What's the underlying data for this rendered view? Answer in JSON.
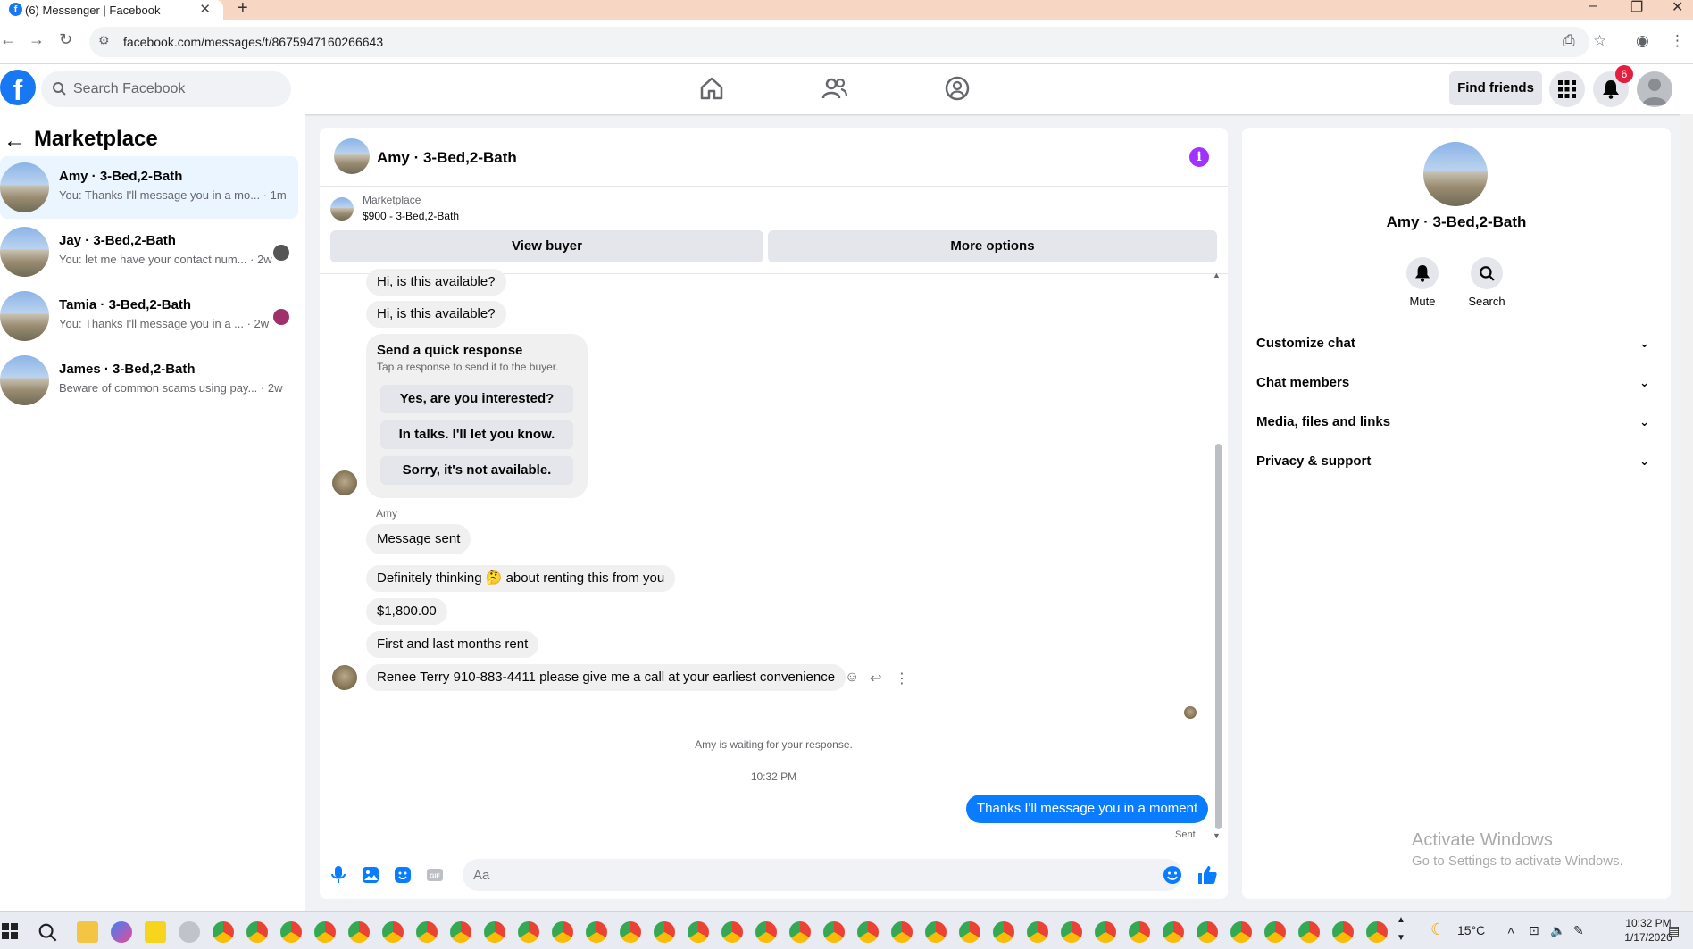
{
  "browser": {
    "tab_title": "(6) Messenger | Facebook",
    "url": "facebook.com/messages/t/8675947160266643",
    "new_tab_symbol": "+"
  },
  "header": {
    "search_placeholder": "Search Facebook",
    "find_friends": "Find friends",
    "notification_count": "6"
  },
  "sidebar": {
    "title": "Marketplace",
    "conversations": [
      {
        "name": "Amy · 3-Bed,2-Bath",
        "preview": "You: Thanks I'll message you in a mo... · 1m",
        "active": true
      },
      {
        "name": "Jay · 3-Bed,2-Bath",
        "preview": "You: let me have your contact num... · 2w",
        "active": false
      },
      {
        "name": "Tamia · 3-Bed,2-Bath",
        "preview": "You: Thanks I'll message you in a ... · 2w",
        "active": false
      },
      {
        "name": "James · 3-Bed,2-Bath",
        "preview": "Beware of common scams using pay... · 2w",
        "active": false
      }
    ]
  },
  "chat": {
    "title": "Amy · 3-Bed,2-Bath",
    "listing_label": "Marketplace",
    "listing_title": "$900 - 3-Bed,2-Bath",
    "view_buyer": "View buyer",
    "more_options": "More options",
    "messages_top": [
      "Hi, is this available?",
      "Hi, is this available?"
    ],
    "quick_response": {
      "title": "Send a quick response",
      "subtitle": "Tap a response to send it to the buyer.",
      "options": [
        "Yes, are you interested?",
        "In talks. I'll let you know.",
        "Sorry, it's not available."
      ]
    },
    "sender": "Amy",
    "messages": [
      "Message sent",
      "Definitely thinking 🤔 about renting this from you",
      "$1,800.00",
      "First and last months rent",
      "Renee Terry 910-883-4411 please give me a call at your earliest convenience"
    ],
    "waiting_notice": "Amy is waiting for your response.",
    "timestamp": "10:32 PM",
    "outgoing": "Thanks I'll message you in a moment",
    "status": "Sent",
    "composer_placeholder": "Aa"
  },
  "info_panel": {
    "name": "Amy · 3-Bed,2-Bath",
    "mute": "Mute",
    "search": "Search",
    "rows": [
      "Customize chat",
      "Chat members",
      "Media, files and links",
      "Privacy & support"
    ]
  },
  "watermark": {
    "line1": "Activate Windows",
    "line2": "Go to Settings to activate Windows."
  },
  "taskbar": {
    "temperature": "15°C",
    "time": "10:32 PM",
    "date": "1/17/2026"
  },
  "colors": {
    "brand": "#1877f2",
    "outgoing_bubble": "#0a7cff",
    "info_icon": "#a033ff",
    "badge": "#e41e3f"
  }
}
